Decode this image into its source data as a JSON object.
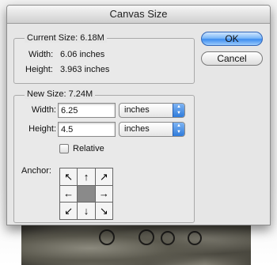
{
  "dialog": {
    "title": "Canvas Size"
  },
  "current_size": {
    "legend_prefix": "Current Size:",
    "value": "6.18M",
    "width_label": "Width:",
    "width_value": "6.06 inches",
    "height_label": "Height:",
    "height_value": "3.963 inches"
  },
  "new_size": {
    "legend_prefix": "New Size:",
    "value": "7.24M",
    "width_label": "Width:",
    "width_value": "6.25",
    "width_unit": "inches",
    "height_label": "Height:",
    "height_value": "4.5",
    "height_unit": "inches",
    "relative_label": "Relative",
    "relative_checked": false,
    "anchor_label": "Anchor:",
    "anchor_arrows": [
      "↖",
      "↑",
      "↗",
      "←",
      "",
      "→",
      "↙",
      "↓",
      "↘"
    ]
  },
  "buttons": {
    "ok": "OK",
    "cancel": "Cancel"
  }
}
